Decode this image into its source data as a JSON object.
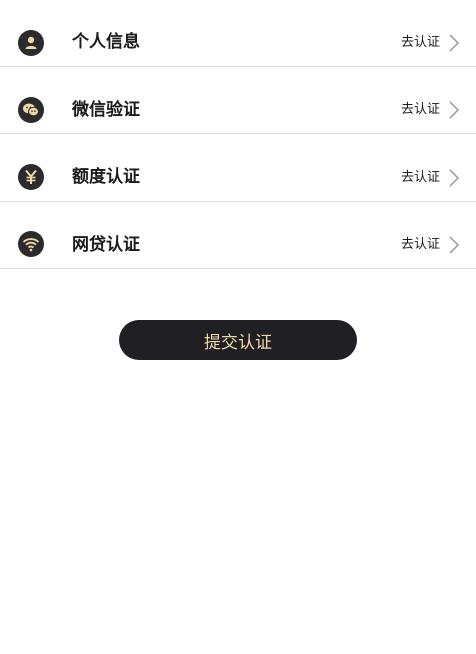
{
  "items": [
    {
      "label": "个人信息",
      "action": "去认证",
      "icon": "user-icon"
    },
    {
      "label": "微信验证",
      "action": "去认证",
      "icon": "wechat-icon"
    },
    {
      "label": "额度认证",
      "action": "去认证",
      "icon": "yen-icon"
    },
    {
      "label": "网贷认证",
      "action": "去认证",
      "icon": "wifi-icon"
    }
  ],
  "submit_label": "提交认证",
  "colors": {
    "accent_gold": "#f0d9a5",
    "dark": "#1f1f24"
  }
}
